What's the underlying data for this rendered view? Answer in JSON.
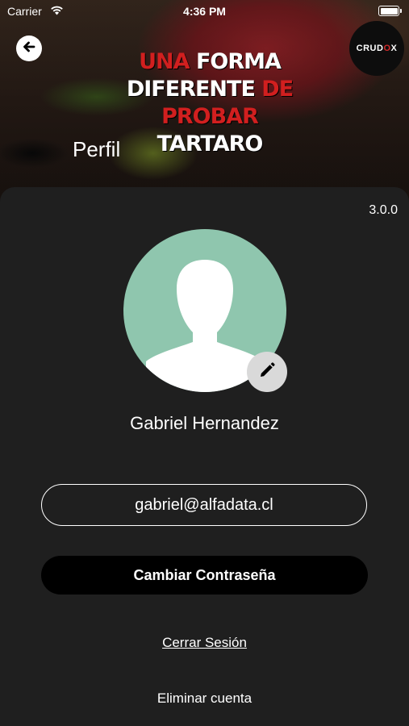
{
  "status_bar": {
    "carrier": "Carrier",
    "time": "4:36 PM"
  },
  "header": {
    "slogan_line1_red": "UNA",
    "slogan_line1_white": "FORMA",
    "slogan_line2_white": "DIFERENTE",
    "slogan_line2_red": "DE",
    "slogan_line3_red": "PROBAR",
    "slogan_line3_white": "TARTARO",
    "logo_text_a": "CRUD",
    "logo_text_b": "O",
    "logo_text_c": "X",
    "page_title": "Perfil"
  },
  "profile": {
    "version": "3.0.0",
    "name": "Gabriel Hernandez",
    "email": "gabriel@alfadata.cl",
    "change_password_label": "Cambiar Contraseña",
    "logout_label": "Cerrar Sesión",
    "delete_account_label": "Eliminar cuenta"
  },
  "colors": {
    "background": "#1f1f1f",
    "avatar_bg": "#8fc6ae",
    "accent_red": "#d11f1f"
  },
  "icons": {
    "back": "arrow-left-circle-icon",
    "edit": "pencil-icon",
    "wifi": "wifi-icon",
    "battery": "battery-icon"
  }
}
